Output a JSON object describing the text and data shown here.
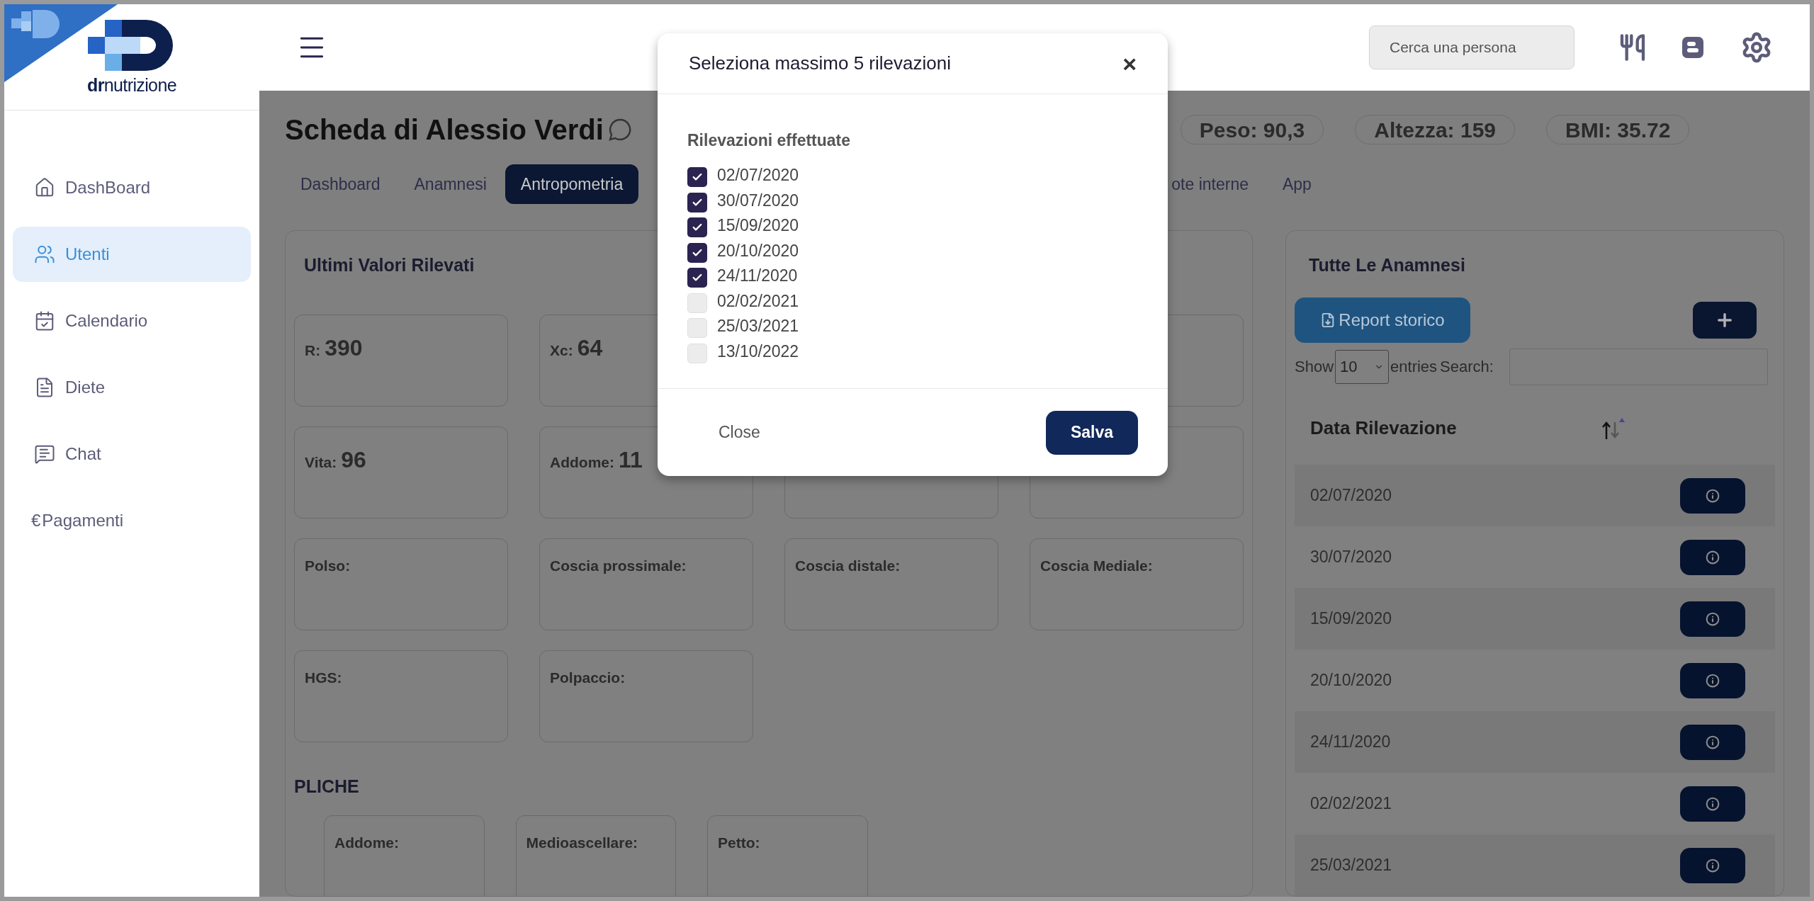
{
  "logo": {
    "text": "**dr**nutrizione"
  },
  "sidebar": {
    "items": [
      {
        "label": "DashBoard",
        "kind": "home",
        "selected": false
      },
      {
        "label": "Utenti",
        "kind": "users",
        "selected": true
      },
      {
        "label": "Calendario",
        "kind": "calendar",
        "selected": false
      },
      {
        "label": "Diete",
        "kind": "file",
        "selected": false
      },
      {
        "label": "Chat",
        "kind": "chat",
        "selected": false
      },
      {
        "label": "Pagamenti",
        "kind": "symbol",
        "symbol": "€",
        "selected": false
      }
    ]
  },
  "header": {
    "search": {
      "placeholder": "Cerca una persona"
    }
  },
  "profile": {
    "title": "Scheda di Alessio Verdi",
    "stats": [
      {
        "label": "Peso:",
        "value": "90,3"
      },
      {
        "label": "Altezza:",
        "value": "159"
      },
      {
        "label": "BMI:",
        "value": "35.72"
      }
    ]
  },
  "tabs": [
    {
      "label": "Dashboard",
      "selected": false
    },
    {
      "label": "Anamnesi",
      "selected": false
    },
    {
      "label": "Antropometria",
      "selected": true
    },
    {
      "label": "ote interne",
      "selected": false
    },
    {
      "label": "App",
      "selected": false
    }
  ],
  "measures": {
    "title": "Ultimi Valori Rilevati",
    "cards": [
      {
        "kind": "field",
        "label": "R:",
        "value": "390"
      },
      {
        "kind": "field",
        "label": "Xc:",
        "value": "64"
      },
      {
        "kind": "hidden"
      },
      {
        "kind": "covered"
      },
      {
        "kind": "field",
        "label": "Vita:",
        "value": "96"
      },
      {
        "kind": "field",
        "label": "Addome:",
        "value": "11"
      },
      {
        "kind": "covered"
      },
      {
        "kind": "covered"
      },
      {
        "kind": "field",
        "label": "Polso:"
      },
      {
        "kind": "field",
        "label": "Coscia prossimale:"
      },
      {
        "kind": "field",
        "label": "Coscia distale:"
      },
      {
        "kind": "field",
        "label": "Coscia Mediale:"
      },
      {
        "kind": "field",
        "label": "HGS:"
      },
      {
        "kind": "field",
        "label": "Polpaccio:"
      }
    ]
  },
  "pliche": {
    "title": "PLICHE",
    "cards": [
      {
        "label": "Addome:"
      },
      {
        "label": "Medioascellare:"
      },
      {
        "label": "Petto:"
      }
    ]
  },
  "history": {
    "title": "Tutte Le Anamnesi",
    "report_button": "Report storico",
    "show_label": "Show",
    "page_size": "10",
    "entries_label": "entries",
    "search_label": "Search:",
    "column": "Data Rilevazione",
    "rows": [
      "02/07/2020",
      "30/07/2020",
      "15/09/2020",
      "20/10/2020",
      "24/11/2020",
      "02/02/2021",
      "25/03/2021"
    ]
  },
  "modal": {
    "title": "Seleziona massimo 5 rilevazioni",
    "close_symbol": "×",
    "section_label": "Rilevazioni effettuate",
    "options": [
      {
        "label": "02/07/2020",
        "checked": true
      },
      {
        "label": "30/07/2020",
        "checked": true
      },
      {
        "label": "15/09/2020",
        "checked": true
      },
      {
        "label": "20/10/2020",
        "checked": true
      },
      {
        "label": "24/11/2020",
        "checked": true
      },
      {
        "label": "02/02/2021",
        "checked": false
      },
      {
        "label": "25/03/2021",
        "checked": false
      },
      {
        "label": "13/10/2022",
        "checked": false
      }
    ],
    "close_button": "Close",
    "save_button": "Salva"
  }
}
